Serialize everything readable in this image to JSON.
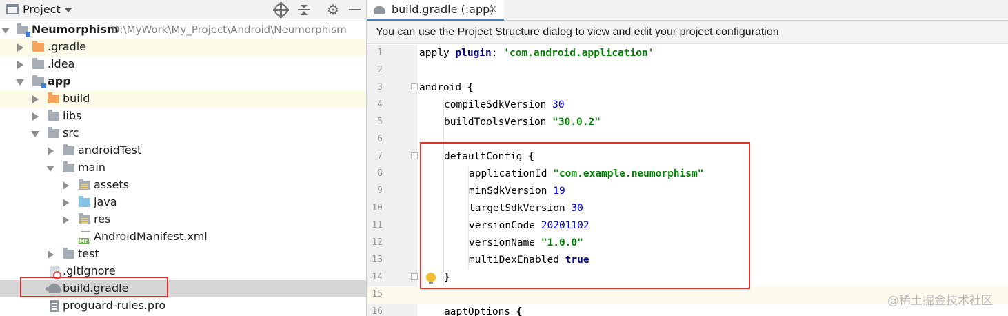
{
  "project_panel": {
    "title": "Project",
    "tree": [
      {
        "label": "Neumorphism",
        "path": "D:\\MyWork\\My_Project\\Android\\Neumorphism",
        "bold": true,
        "expanded": true
      },
      {
        "label": ".gradle"
      },
      {
        "label": ".idea"
      },
      {
        "label": "app",
        "bold": true,
        "expanded": true
      },
      {
        "label": "build"
      },
      {
        "label": "libs"
      },
      {
        "label": "src",
        "expanded": true
      },
      {
        "label": "androidTest"
      },
      {
        "label": "main",
        "expanded": true
      },
      {
        "label": "assets"
      },
      {
        "label": "java"
      },
      {
        "label": "res"
      },
      {
        "label": "AndroidManifest.xml",
        "badge": "MF"
      },
      {
        "label": "test"
      },
      {
        "label": ".gitignore"
      },
      {
        "label": "build.gradle",
        "selected": true
      },
      {
        "label": "proguard-rules.pro"
      }
    ]
  },
  "editor": {
    "tab_label": "build.gradle (:app)",
    "tab_close": "×",
    "notification": "You can use the Project Structure dialog to view and edit your project configuration",
    "line_numbers": [
      "1",
      "2",
      "3",
      "4",
      "5",
      "6",
      "7",
      "8",
      "9",
      "10",
      "11",
      "12",
      "13",
      "14",
      "15",
      "16"
    ],
    "code": {
      "l1_a": "apply ",
      "l1_b": "plugin",
      "l1_c": ": ",
      "l1_d": "'com.android.application'",
      "l3_a": "android ",
      "l3_b": "{",
      "l4_a": "compileSdkVersion ",
      "l4_b": "30",
      "l5_a": "buildToolsVersion ",
      "l5_b": "\"30.0.2\"",
      "l7_a": "defaultConfig ",
      "l7_b": "{",
      "l8_a": "applicationId ",
      "l8_b": "\"com.example.neumorphism\"",
      "l9_a": "minSdkVersion ",
      "l9_b": "19",
      "l10_a": "targetSdkVersion ",
      "l10_b": "30",
      "l11_a": "versionCode ",
      "l11_b": "20201102",
      "l12_a": "versionName ",
      "l12_b": "\"1.0.0\"",
      "l13_a": "multiDexEnabled ",
      "l13_b": "true",
      "l14_a": "}",
      "l16_a": "aaptOptions ",
      "l16_b": "{"
    }
  },
  "watermark": "@稀土掘金技术社区",
  "colors": {
    "accent_tab": "#4083c9",
    "highlight_box": "#e0302e",
    "keyword": "#000080",
    "string": "#008000",
    "number": "#0000ff"
  },
  "icons": [
    "window-icon",
    "dropdown-icon",
    "locate-icon",
    "collapse-icon",
    "gear-icon",
    "minimize-icon",
    "folder-icon",
    "gradle-icon",
    "lightbulb-icon",
    "fold-icon"
  ]
}
